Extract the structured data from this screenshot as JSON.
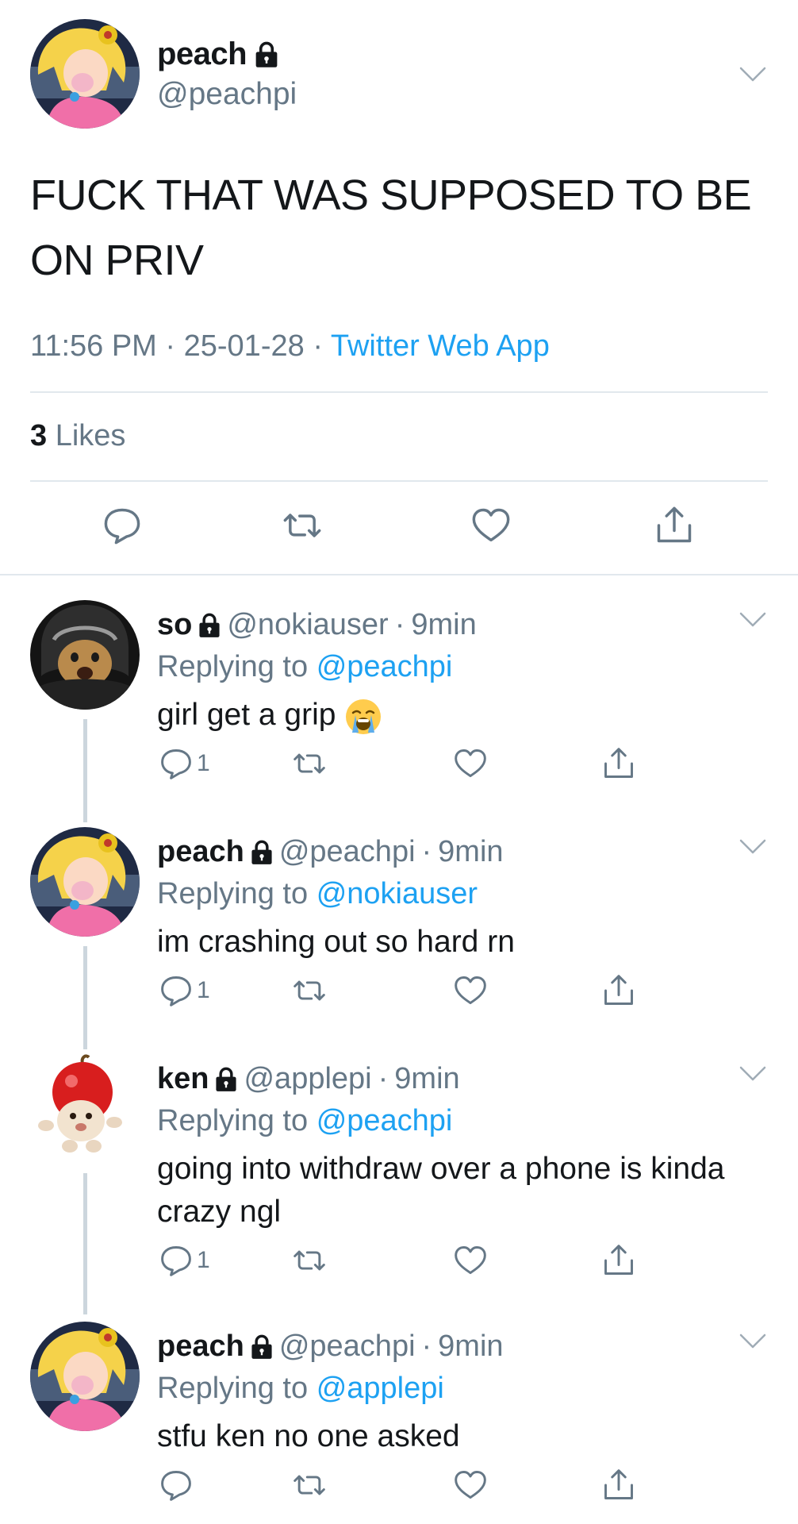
{
  "main_tweet": {
    "display_name": "peach",
    "handle": "@peachpi",
    "text": "FUCK THAT WAS SUPPOSED TO BE ON PRIV",
    "time": "11:56 PM",
    "date": "25-01-28",
    "source": "Twitter Web App",
    "likes_count": "3",
    "likes_label": "Likes"
  },
  "replies": [
    {
      "name": "so",
      "handle": "@nokiauser",
      "time": "9min",
      "replying_label": "Replying to",
      "replying_to": "@peachpi",
      "text": "girl get a grip",
      "emoji": "loudly-crying-face",
      "reply_count": "1"
    },
    {
      "name": "peach",
      "handle": "@peachpi",
      "time": "9min",
      "replying_label": "Replying to",
      "replying_to": "@nokiauser",
      "text": "im crashing out so hard rn",
      "reply_count": "1"
    },
    {
      "name": "ken",
      "handle": "@applepi",
      "time": "9min",
      "replying_label": "Replying to",
      "replying_to": "@peachpi",
      "text": "going into withdraw over a phone is kinda crazy ngl",
      "reply_count": "1"
    },
    {
      "name": "peach",
      "handle": "@peachpi",
      "time": "9min",
      "replying_label": "Replying to",
      "replying_to": "@applepi",
      "text": "stfu ken no one asked",
      "reply_count": ""
    }
  ],
  "separator": "·",
  "colors": {
    "link": "#1da1f2",
    "secondary": "#657786",
    "divider": "#e1e8ed",
    "thread": "#ccd6dd"
  },
  "icons": [
    "lock-icon",
    "chevron-down-icon",
    "reply-icon",
    "retweet-icon",
    "like-icon",
    "share-icon"
  ]
}
